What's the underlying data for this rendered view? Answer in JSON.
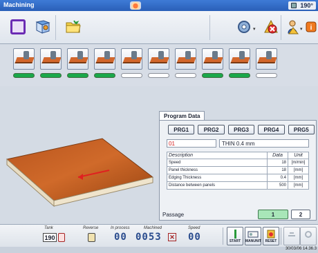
{
  "window": {
    "title": "Machining",
    "temperature": "190°"
  },
  "tools_strip": {
    "tools": [
      {
        "name": "tool-1",
        "active": true
      },
      {
        "name": "tool-2",
        "active": true
      },
      {
        "name": "tool-3",
        "active": true
      },
      {
        "name": "tool-4",
        "active": true
      },
      {
        "name": "tool-5",
        "active": false
      },
      {
        "name": "tool-6",
        "active": false
      },
      {
        "name": "tool-7",
        "active": false
      },
      {
        "name": "tool-8",
        "active": true
      },
      {
        "name": "tool-9",
        "active": true
      },
      {
        "name": "tool-10",
        "active": false
      }
    ]
  },
  "program": {
    "tab_label": "Program Data",
    "prg_buttons": [
      "PRG1",
      "PRG2",
      "PRG3",
      "PRG4",
      "PRG5"
    ],
    "number": "01",
    "name": "THIN 0.4 mm",
    "table": {
      "headers": {
        "description": "Description",
        "data": "Data",
        "unit": "Unit"
      },
      "rows": [
        {
          "description": "Speed",
          "data": "18",
          "unit": "[m/min]"
        },
        {
          "description": "Panel thickness",
          "data": "18",
          "unit": "[mm]"
        },
        {
          "description": "Edging Thickness",
          "data": "0.4",
          "unit": "[mm]"
        },
        {
          "description": "Distance between panels",
          "data": "500",
          "unit": "[mm]"
        }
      ]
    },
    "passage_label": "Passage",
    "passage_1": "1",
    "passage_2": "2"
  },
  "status_bar": {
    "tank_label": "Tank",
    "tank_value": "190",
    "reverse_label": "Reverse",
    "in_process_label": "In process",
    "in_process_value": "00",
    "machined_label": "Machined",
    "machined_value": "0053",
    "speed_label": "Speed",
    "speed_value": "00",
    "start_label": "START",
    "manunit_label": "MANUNIT",
    "reset_label": "RESET"
  },
  "footer": {
    "timestamp": "30/03/06 14.36.3"
  },
  "colors": {
    "titlebar": "#2a5fb8",
    "active_tool": "#1aa84a",
    "passage_active": "#a8e6b8",
    "program_number": "#d21818"
  }
}
